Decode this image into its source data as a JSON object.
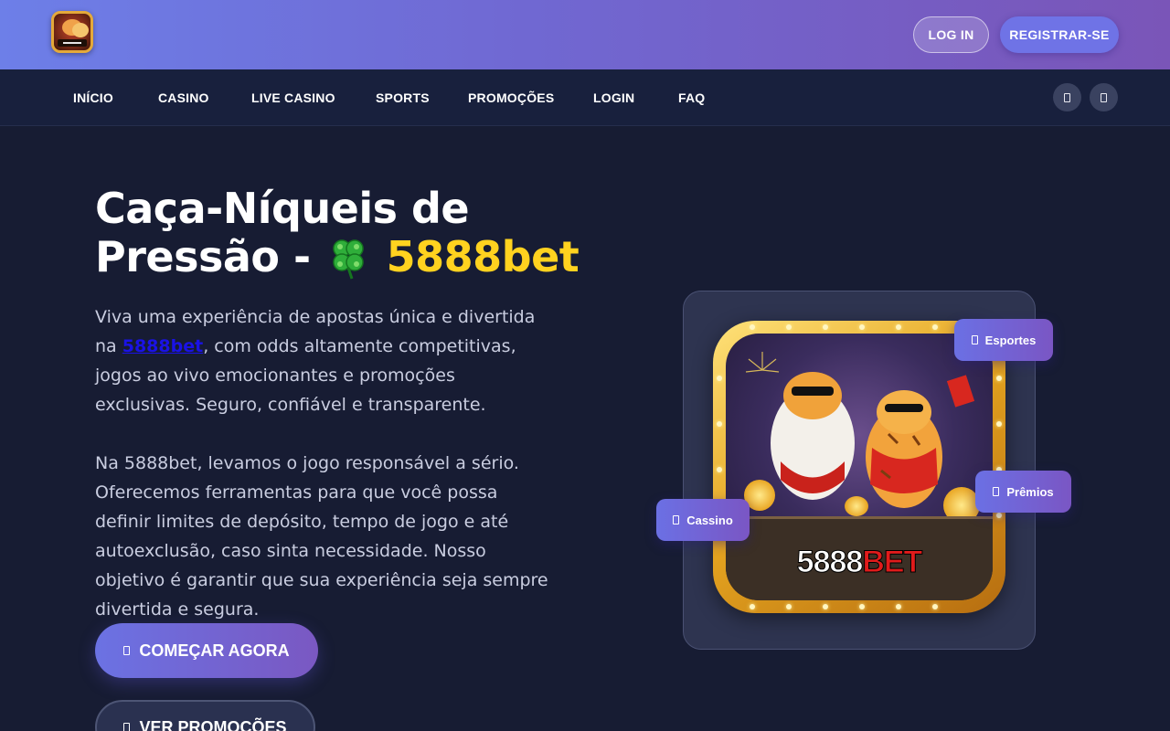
{
  "header": {
    "logo_icon": "game-logo-icon",
    "login_label": "LOG IN",
    "register_label": "REGISTRAR-SE"
  },
  "nav": {
    "items": [
      "INÍCIO",
      "CASINO",
      "LIVE CASINO",
      "SPORTS",
      "PROMOÇÕES",
      "LOGIN",
      "FAQ"
    ],
    "icons": [
      "icon-button",
      "icon-button"
    ]
  },
  "hero": {
    "title_line1": "Caça-Níqueis de",
    "title_line2_prefix": "Pressão - ",
    "title_emoji": "four-leaf-clover-icon",
    "title_brand": "5888bet",
    "para1_start": "Viva uma experiência de apostas única e divertida na ",
    "para1_link": "5888bet",
    "para1_end": ", com odds altamente competitivas, jogos ao vivo emocionantes e promoções exclusivas. Seguro, confiável e transparente.",
    "para2": "Na 5888bet, levamos o jogo responsável a sério. Oferecemos ferramentas para que você possa definir limites de depósito, tempo de jogo e até autoexclusão, caso sinta necessidade. Nosso objetivo é garantir que sua experiência seja sempre divertida e segura.",
    "cta_primary": "COMEÇAR AGORA",
    "cta_secondary": "VER PROMOÇÕES",
    "game_logo_part1": "5888",
    "game_logo_part2": "BET",
    "tags": {
      "sports": "Esportes",
      "prizes": "Prêmios",
      "casino": "Cassino"
    }
  },
  "colors": {
    "header_gradient_start": "#6d7fe8",
    "header_gradient_end": "#7a55b8",
    "background": "#171c33",
    "brand_yellow": "#ffd21f",
    "accent_purple": "#6f73e6"
  }
}
